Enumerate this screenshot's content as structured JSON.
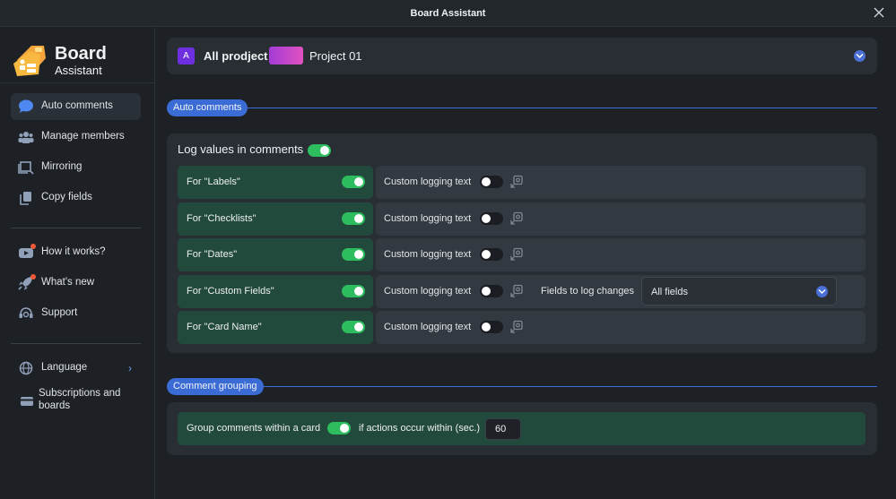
{
  "window": {
    "title": "Board Assistant"
  },
  "brand": {
    "line1": "Board",
    "line2": "Assistant"
  },
  "nav": {
    "primary": [
      {
        "label": "Auto comments",
        "icon": "chat-bubble-icon",
        "active": true
      },
      {
        "label": "Manage members",
        "icon": "people-icon"
      },
      {
        "label": "Mirroring",
        "icon": "mirror-icon"
      },
      {
        "label": "Copy fields",
        "icon": "copy-icon"
      }
    ],
    "secondary": [
      {
        "label": "How it works?",
        "icon": "youtube-icon",
        "notify": true
      },
      {
        "label": "What's new",
        "icon": "rocket-icon",
        "notify": true
      },
      {
        "label": "Support",
        "icon": "support-icon"
      }
    ],
    "tertiary": [
      {
        "label": "Language",
        "icon": "globe-icon"
      },
      {
        "label": "Subscriptions and boards",
        "icon": "card-icon"
      }
    ]
  },
  "project_bar": {
    "badge": "A",
    "all_label": "All prodject",
    "project_name": "Project 01"
  },
  "auto_comments": {
    "section_label": "Auto comments",
    "log_title": "Log values in comments",
    "log_enabled": true,
    "rows": [
      {
        "label": "For \"Labels\"",
        "enabled": true,
        "custom_label": "Custom logging text",
        "custom_enabled": false
      },
      {
        "label": "For \"Checklists\"",
        "enabled": true,
        "custom_label": "Custom logging text",
        "custom_enabled": false
      },
      {
        "label": "For \"Dates\"",
        "enabled": true,
        "custom_label": "Custom logging text",
        "custom_enabled": false
      },
      {
        "label": "For \"Custom Fields\"",
        "enabled": true,
        "custom_label": "Custom logging text",
        "custom_enabled": false,
        "fields_label": "Fields to log changes",
        "fields_value": "All fields"
      },
      {
        "label": "For \"Card Name\"",
        "enabled": true,
        "custom_label": "Custom logging text",
        "custom_enabled": false
      }
    ]
  },
  "comment_grouping": {
    "section_label": "Comment grouping",
    "label_before": "Group comments within a card",
    "enabled": true,
    "label_after": "if actions occur within (sec.)",
    "seconds": "60"
  },
  "colors": {
    "accent": "#3b6cd6",
    "toggle_on": "#2dbd5f",
    "row_green": "#224a3c"
  }
}
